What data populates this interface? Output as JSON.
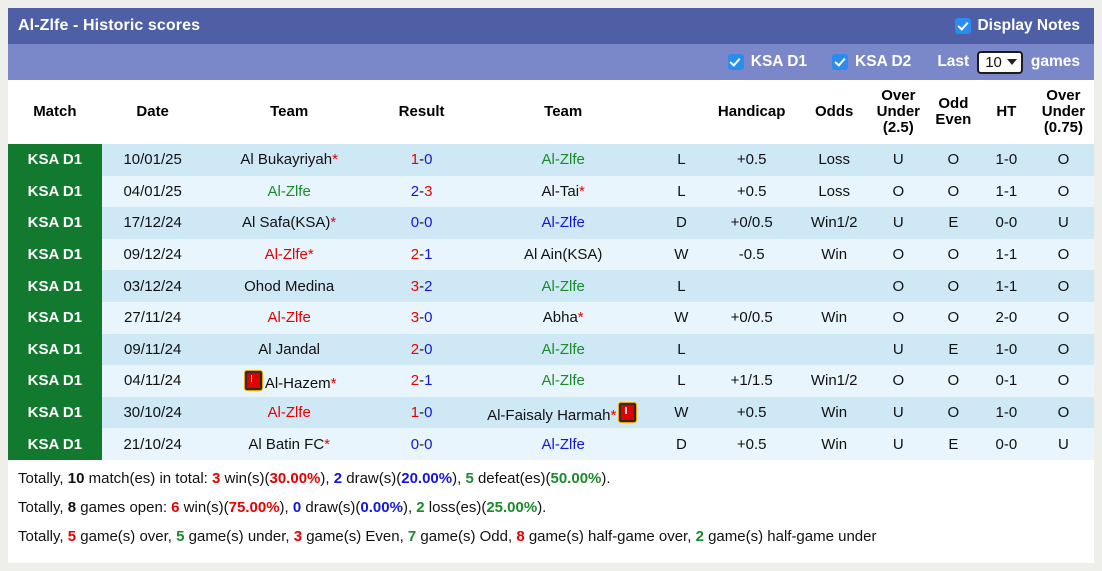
{
  "header": {
    "title": "Al-Zlfe - Historic scores",
    "display_notes_label": "Display Notes",
    "display_notes_checked": true,
    "filters": [
      {
        "label": "KSA D1",
        "checked": true
      },
      {
        "label": "KSA D2",
        "checked": true
      }
    ],
    "last_label": "Last",
    "games_count": "10",
    "games_label": "games"
  },
  "columns": [
    {
      "key": "match",
      "label": "Match"
    },
    {
      "key": "date",
      "label": "Date"
    },
    {
      "key": "team1",
      "label": "Team"
    },
    {
      "key": "result",
      "label": "Result"
    },
    {
      "key": "team2",
      "label": "Team"
    },
    {
      "key": "wl",
      "label": ""
    },
    {
      "key": "handicap",
      "label": "Handicap"
    },
    {
      "key": "odds",
      "label": "Odds"
    },
    {
      "key": "ou25",
      "label": "Over Under (2.5)",
      "lines": [
        "Over",
        "Under",
        "(2.5)"
      ]
    },
    {
      "key": "oddeven",
      "label": "Odd Even",
      "lines": [
        "Odd",
        "Even"
      ]
    },
    {
      "key": "ht",
      "label": "HT"
    },
    {
      "key": "ou075",
      "label": "Over Under (0.75)",
      "lines": [
        "Over",
        "Under",
        "(0.75)"
      ]
    }
  ],
  "rows": [
    {
      "league": "KSA D1",
      "date": "10/01/25",
      "team1": "Al Bukayriyah",
      "team1_color": "black",
      "team1_star": true,
      "team1_card": false,
      "score_home": "1",
      "score_away": "0",
      "score_home_color": "red",
      "score_away_color": "blue",
      "team2": "Al-Zlfe",
      "team2_color": "green",
      "team2_star": false,
      "team2_card": false,
      "wl": "L",
      "wl_color": "green",
      "handicap": "+0.5",
      "odds": "Loss",
      "odds_color": "green",
      "ou25": "U",
      "ou25_color": "green",
      "oddeven": "O",
      "oddeven_color": "green",
      "ht": "1-0",
      "ou075": "O",
      "ou075_color": "red"
    },
    {
      "league": "KSA D1",
      "date": "04/01/25",
      "team1": "Al-Zlfe",
      "team1_color": "green",
      "team1_star": false,
      "team1_card": false,
      "score_home": "2",
      "score_away": "3",
      "score_home_color": "blue",
      "score_away_color": "red",
      "team2": "Al-Tai",
      "team2_color": "black",
      "team2_star": true,
      "team2_card": false,
      "wl": "L",
      "wl_color": "green",
      "handicap": "+0.5",
      "odds": "Loss",
      "odds_color": "green",
      "ou25": "O",
      "ou25_color": "red",
      "oddeven": "O",
      "oddeven_color": "green",
      "ht": "1-1",
      "ou075": "O",
      "ou075_color": "red"
    },
    {
      "league": "KSA D1",
      "date": "17/12/24",
      "team1": "Al Safa(KSA)",
      "team1_color": "black",
      "team1_star": true,
      "team1_card": false,
      "score_home": "0",
      "score_away": "0",
      "score_home_color": "blue",
      "score_away_color": "blue",
      "team2": "Al-Zlfe",
      "team2_color": "blue",
      "team2_star": false,
      "team2_card": false,
      "wl": "D",
      "wl_color": "blue",
      "handicap": "+0/0.5",
      "odds": "Win1/2",
      "odds_color": "red",
      "ou25": "U",
      "ou25_color": "green",
      "oddeven": "E",
      "oddeven_color": "red",
      "ht": "0-0",
      "ou075": "U",
      "ou075_color": "green"
    },
    {
      "league": "KSA D1",
      "date": "09/12/24",
      "team1": "Al-Zlfe",
      "team1_color": "red",
      "team1_star": true,
      "team1_card": false,
      "score_home": "2",
      "score_away": "1",
      "score_home_color": "red",
      "score_away_color": "blue",
      "team2": "Al Ain(KSA)",
      "team2_color": "black",
      "team2_star": false,
      "team2_card": false,
      "wl": "W",
      "wl_color": "red",
      "handicap": "-0.5",
      "odds": "Win",
      "odds_color": "red",
      "ou25": "O",
      "ou25_color": "red",
      "oddeven": "O",
      "oddeven_color": "green",
      "ht": "1-1",
      "ou075": "O",
      "ou075_color": "red"
    },
    {
      "league": "KSA D1",
      "date": "03/12/24",
      "team1": "Ohod Medina",
      "team1_color": "black",
      "team1_star": false,
      "team1_card": false,
      "score_home": "3",
      "score_away": "2",
      "score_home_color": "red",
      "score_away_color": "blue",
      "team2": "Al-Zlfe",
      "team2_color": "green",
      "team2_star": false,
      "team2_card": false,
      "wl": "L",
      "wl_color": "green",
      "handicap": "",
      "odds": "",
      "odds_color": "black",
      "ou25": "O",
      "ou25_color": "red",
      "oddeven": "O",
      "oddeven_color": "green",
      "ht": "1-1",
      "ou075": "O",
      "ou075_color": "red"
    },
    {
      "league": "KSA D1",
      "date": "27/11/24",
      "team1": "Al-Zlfe",
      "team1_color": "red",
      "team1_star": false,
      "team1_card": false,
      "score_home": "3",
      "score_away": "0",
      "score_home_color": "red",
      "score_away_color": "blue",
      "team2": "Abha",
      "team2_color": "black",
      "team2_star": true,
      "team2_card": false,
      "wl": "W",
      "wl_color": "red",
      "handicap": "+0/0.5",
      "odds": "Win",
      "odds_color": "red",
      "ou25": "O",
      "ou25_color": "red",
      "oddeven": "O",
      "oddeven_color": "green",
      "ht": "2-0",
      "ou075": "O",
      "ou075_color": "red"
    },
    {
      "league": "KSA D1",
      "date": "09/11/24",
      "team1": "Al Jandal",
      "team1_color": "black",
      "team1_star": false,
      "team1_card": false,
      "score_home": "2",
      "score_away": "0",
      "score_home_color": "red",
      "score_away_color": "blue",
      "team2": "Al-Zlfe",
      "team2_color": "green",
      "team2_star": false,
      "team2_card": false,
      "wl": "L",
      "wl_color": "green",
      "handicap": "",
      "odds": "",
      "odds_color": "black",
      "ou25": "U",
      "ou25_color": "green",
      "oddeven": "E",
      "oddeven_color": "red",
      "ht": "1-0",
      "ou075": "O",
      "ou075_color": "red"
    },
    {
      "league": "KSA D1",
      "date": "04/11/24",
      "team1": "Al-Hazem",
      "team1_color": "black",
      "team1_star": true,
      "team1_card": true,
      "team1_card_pos": "before",
      "score_home": "2",
      "score_away": "1",
      "score_home_color": "red",
      "score_away_color": "blue",
      "team2": "Al-Zlfe",
      "team2_color": "green",
      "team2_star": false,
      "team2_card": false,
      "wl": "L",
      "wl_color": "green",
      "handicap": "+1/1.5",
      "odds": "Win1/2",
      "odds_color": "red",
      "ou25": "O",
      "ou25_color": "red",
      "oddeven": "O",
      "oddeven_color": "green",
      "ht": "0-1",
      "ou075": "O",
      "ou075_color": "red"
    },
    {
      "league": "KSA D1",
      "date": "30/10/24",
      "team1": "Al-Zlfe",
      "team1_color": "red",
      "team1_star": false,
      "team1_card": false,
      "score_home": "1",
      "score_away": "0",
      "score_home_color": "red",
      "score_away_color": "blue",
      "team2": "Al-Faisaly Harmah",
      "team2_color": "black",
      "team2_star": true,
      "team2_card": true,
      "team2_card_pos": "after",
      "wl": "W",
      "wl_color": "red",
      "handicap": "+0.5",
      "odds": "Win",
      "odds_color": "red",
      "ou25": "U",
      "ou25_color": "green",
      "oddeven": "O",
      "oddeven_color": "green",
      "ht": "1-0",
      "ou075": "O",
      "ou075_color": "red"
    },
    {
      "league": "KSA D1",
      "date": "21/10/24",
      "team1": "Al Batin FC",
      "team1_color": "black",
      "team1_star": true,
      "team1_card": false,
      "score_home": "0",
      "score_away": "0",
      "score_home_color": "blue",
      "score_away_color": "blue",
      "team2": "Al-Zlfe",
      "team2_color": "blue",
      "team2_star": false,
      "team2_card": false,
      "wl": "D",
      "wl_color": "blue",
      "handicap": "+0.5",
      "odds": "Win",
      "odds_color": "red",
      "ou25": "U",
      "ou25_color": "green",
      "oddeven": "E",
      "oddeven_color": "red",
      "ht": "0-0",
      "ou075": "U",
      "ou075_color": "green"
    }
  ],
  "summary": {
    "line1": [
      {
        "t": "Totally, ",
        "c": "black",
        "b": false
      },
      {
        "t": "10",
        "c": "black",
        "b": true
      },
      {
        "t": " match(es) in total: ",
        "c": "black",
        "b": false
      },
      {
        "t": "3",
        "c": "red",
        "b": true
      },
      {
        "t": " win(s)(",
        "c": "black",
        "b": false
      },
      {
        "t": "30.00%",
        "c": "red",
        "b": true
      },
      {
        "t": "), ",
        "c": "black",
        "b": false
      },
      {
        "t": "2",
        "c": "blue",
        "b": true
      },
      {
        "t": " draw(s)(",
        "c": "black",
        "b": false
      },
      {
        "t": "20.00%",
        "c": "blue",
        "b": true
      },
      {
        "t": "), ",
        "c": "black",
        "b": false
      },
      {
        "t": "5",
        "c": "green",
        "b": true
      },
      {
        "t": " defeat(es)(",
        "c": "black",
        "b": false
      },
      {
        "t": "50.00%",
        "c": "green",
        "b": true
      },
      {
        "t": ").",
        "c": "black",
        "b": false
      }
    ],
    "line2": [
      {
        "t": "Totally, ",
        "c": "black",
        "b": false
      },
      {
        "t": "8",
        "c": "black",
        "b": true
      },
      {
        "t": " games open: ",
        "c": "black",
        "b": false
      },
      {
        "t": "6",
        "c": "red",
        "b": true
      },
      {
        "t": " win(s)(",
        "c": "black",
        "b": false
      },
      {
        "t": "75.00%",
        "c": "red",
        "b": true
      },
      {
        "t": "), ",
        "c": "black",
        "b": false
      },
      {
        "t": "0",
        "c": "blue",
        "b": true
      },
      {
        "t": " draw(s)(",
        "c": "black",
        "b": false
      },
      {
        "t": "0.00%",
        "c": "blue",
        "b": true
      },
      {
        "t": "), ",
        "c": "black",
        "b": false
      },
      {
        "t": "2",
        "c": "green",
        "b": true
      },
      {
        "t": " loss(es)(",
        "c": "black",
        "b": false
      },
      {
        "t": "25.00%",
        "c": "green",
        "b": true
      },
      {
        "t": ").",
        "c": "black",
        "b": false
      }
    ],
    "line3": [
      {
        "t": "Totally, ",
        "c": "black",
        "b": false
      },
      {
        "t": "5",
        "c": "red",
        "b": true
      },
      {
        "t": " game(s) over, ",
        "c": "black",
        "b": false
      },
      {
        "t": "5",
        "c": "green",
        "b": true
      },
      {
        "t": " game(s) under, ",
        "c": "black",
        "b": false
      },
      {
        "t": "3",
        "c": "red",
        "b": true
      },
      {
        "t": " game(s) Even, ",
        "c": "black",
        "b": false
      },
      {
        "t": "7",
        "c": "green",
        "b": true
      },
      {
        "t": " game(s) Odd, ",
        "c": "black",
        "b": false
      },
      {
        "t": "8",
        "c": "red",
        "b": true
      },
      {
        "t": " game(s) half-game over, ",
        "c": "black",
        "b": false
      },
      {
        "t": "2",
        "c": "green",
        "b": true
      },
      {
        "t": " game(s) half-game under",
        "c": "black",
        "b": false
      }
    ]
  },
  "colors": {
    "header_dark": "#4e5fa6",
    "header_light": "#7a87c8",
    "league_green": "#127a2e",
    "row_odd": "#cfe8f6",
    "row_even": "#e9f5fc",
    "win_red": "#e60000",
    "loss_green": "#1b8a2a",
    "draw_blue": "#1515e0",
    "checkbox_blue": "#2b8cf0"
  }
}
